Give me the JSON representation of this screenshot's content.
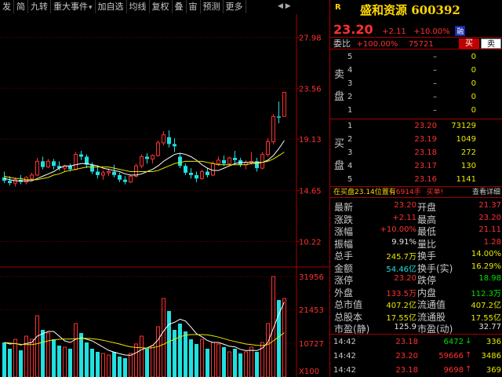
{
  "toolbar": {
    "items": [
      {
        "label": "发",
        "dropdown": false
      },
      {
        "label": "简",
        "dropdown": false
      },
      {
        "label": "九转",
        "dropdown": false
      },
      {
        "label": "重大事件",
        "dropdown": true
      },
      {
        "label": "加自选",
        "dropdown": false
      },
      {
        "label": "均线",
        "dropdown": false
      },
      {
        "label": "复权",
        "dropdown": false
      },
      {
        "label": "叠",
        "dropdown": false
      },
      {
        "label": "宙",
        "dropdown": false
      },
      {
        "label": "预测",
        "dropdown": false
      },
      {
        "label": "更多",
        "dropdown": false
      }
    ],
    "scroll_arrows": "◀ ▶"
  },
  "chart_data": {
    "type": "candlestick",
    "price_axis": {
      "ticks": [
        "27.98",
        "23.56",
        "19.13",
        "14.65",
        "10.22"
      ],
      "ylim": [
        8.0,
        30.0
      ]
    },
    "volume_axis": {
      "ticks": [
        "31956",
        "21453",
        "10727"
      ],
      "unit_label": "X100",
      "ylim": [
        0,
        35000
      ]
    },
    "colors": {
      "up": "#ff3030",
      "down": "#20e0e0",
      "ma1": "#ffffff",
      "ma2": "#e8e800",
      "grid": "#6a0000"
    },
    "candles": [
      {
        "o": 15.8,
        "h": 16.3,
        "l": 15.3,
        "c": 15.5
      },
      {
        "o": 15.5,
        "h": 15.9,
        "l": 15.1,
        "c": 15.3
      },
      {
        "o": 15.3,
        "h": 15.8,
        "l": 15.0,
        "c": 15.6
      },
      {
        "o": 15.6,
        "h": 16.0,
        "l": 15.2,
        "c": 15.4
      },
      {
        "o": 15.4,
        "h": 15.9,
        "l": 15.2,
        "c": 15.8
      },
      {
        "o": 15.7,
        "h": 16.2,
        "l": 15.5,
        "c": 16.0
      },
      {
        "o": 16.0,
        "h": 17.5,
        "l": 15.9,
        "c": 17.2
      },
      {
        "o": 17.2,
        "h": 17.6,
        "l": 16.5,
        "c": 16.7
      },
      {
        "o": 16.7,
        "h": 17.4,
        "l": 16.6,
        "c": 17.2
      },
      {
        "o": 17.2,
        "h": 17.4,
        "l": 16.5,
        "c": 16.8
      },
      {
        "o": 16.8,
        "h": 17.2,
        "l": 16.4,
        "c": 16.6
      },
      {
        "o": 16.6,
        "h": 16.9,
        "l": 16.3,
        "c": 16.8
      },
      {
        "o": 16.8,
        "h": 17.0,
        "l": 16.3,
        "c": 16.5
      },
      {
        "o": 16.5,
        "h": 18.0,
        "l": 16.4,
        "c": 17.8
      },
      {
        "o": 17.8,
        "h": 18.1,
        "l": 17.3,
        "c": 17.6
      },
      {
        "o": 17.6,
        "h": 17.8,
        "l": 16.6,
        "c": 16.9
      },
      {
        "o": 16.9,
        "h": 17.1,
        "l": 16.1,
        "c": 16.3
      },
      {
        "o": 16.3,
        "h": 16.8,
        "l": 15.7,
        "c": 16.0
      },
      {
        "o": 16.0,
        "h": 16.4,
        "l": 15.6,
        "c": 16.2
      },
      {
        "o": 16.2,
        "h": 16.6,
        "l": 15.9,
        "c": 16.3
      },
      {
        "o": 16.3,
        "h": 16.9,
        "l": 15.8,
        "c": 16.0
      },
      {
        "o": 16.0,
        "h": 16.2,
        "l": 15.4,
        "c": 15.6
      },
      {
        "o": 15.6,
        "h": 15.9,
        "l": 15.2,
        "c": 15.4
      },
      {
        "o": 15.4,
        "h": 16.0,
        "l": 15.3,
        "c": 15.9
      },
      {
        "o": 15.9,
        "h": 17.0,
        "l": 15.8,
        "c": 16.8
      },
      {
        "o": 16.8,
        "h": 17.8,
        "l": 16.6,
        "c": 17.6
      },
      {
        "o": 17.6,
        "h": 17.9,
        "l": 17.0,
        "c": 17.4
      },
      {
        "o": 17.4,
        "h": 17.8,
        "l": 17.0,
        "c": 17.7
      },
      {
        "o": 17.7,
        "h": 19.0,
        "l": 17.6,
        "c": 18.8
      },
      {
        "o": 18.8,
        "h": 19.8,
        "l": 18.6,
        "c": 19.5
      },
      {
        "o": 19.3,
        "h": 19.9,
        "l": 18.4,
        "c": 18.7
      },
      {
        "o": 18.7,
        "h": 19.2,
        "l": 18.0,
        "c": 18.5
      },
      {
        "o": 17.6,
        "h": 17.9,
        "l": 16.6,
        "c": 16.8
      },
      {
        "o": 16.8,
        "h": 17.0,
        "l": 16.0,
        "c": 16.2
      },
      {
        "o": 16.2,
        "h": 16.6,
        "l": 15.7,
        "c": 16.0
      },
      {
        "o": 16.0,
        "h": 16.3,
        "l": 15.4,
        "c": 15.7
      },
      {
        "o": 15.7,
        "h": 16.5,
        "l": 15.6,
        "c": 16.3
      },
      {
        "o": 16.3,
        "h": 16.6,
        "l": 15.8,
        "c": 16.0
      },
      {
        "o": 16.0,
        "h": 17.2,
        "l": 15.9,
        "c": 17.0
      },
      {
        "o": 17.0,
        "h": 17.6,
        "l": 16.8,
        "c": 17.3
      },
      {
        "o": 17.3,
        "h": 17.7,
        "l": 16.8,
        "c": 17.0
      },
      {
        "o": 17.0,
        "h": 17.6,
        "l": 16.9,
        "c": 17.5
      },
      {
        "o": 17.5,
        "h": 18.1,
        "l": 17.0,
        "c": 17.3
      },
      {
        "o": 17.3,
        "h": 17.5,
        "l": 16.7,
        "c": 16.9
      },
      {
        "o": 16.9,
        "h": 17.3,
        "l": 16.5,
        "c": 17.1
      },
      {
        "o": 17.1,
        "h": 18.0,
        "l": 16.9,
        "c": 17.2
      },
      {
        "o": 17.2,
        "h": 17.5,
        "l": 16.3,
        "c": 16.6
      },
      {
        "o": 16.6,
        "h": 18.0,
        "l": 16.5,
        "c": 17.8
      },
      {
        "o": 17.8,
        "h": 19.2,
        "l": 17.6,
        "c": 18.9
      },
      {
        "o": 18.9,
        "h": 21.3,
        "l": 18.7,
        "c": 21.1
      },
      {
        "o": 21.1,
        "h": 22.4,
        "l": 20.5,
        "c": 21.0
      },
      {
        "o": 21.1,
        "h": 23.2,
        "l": 21.1,
        "c": 23.2
      }
    ],
    "volumes": [
      {
        "v": 11000,
        "up": false
      },
      {
        "v": 9000,
        "up": false
      },
      {
        "v": 12000,
        "up": true
      },
      {
        "v": 8500,
        "up": false
      },
      {
        "v": 13000,
        "up": true
      },
      {
        "v": 12000,
        "up": true
      },
      {
        "v": 19500,
        "up": true
      },
      {
        "v": 15000,
        "up": false
      },
      {
        "v": 14000,
        "up": true
      },
      {
        "v": 12000,
        "up": false
      },
      {
        "v": 10000,
        "up": false
      },
      {
        "v": 9500,
        "up": true
      },
      {
        "v": 9000,
        "up": false
      },
      {
        "v": 17000,
        "up": true
      },
      {
        "v": 14000,
        "up": false
      },
      {
        "v": 11000,
        "up": false
      },
      {
        "v": 9000,
        "up": false
      },
      {
        "v": 8000,
        "up": false
      },
      {
        "v": 7500,
        "up": true
      },
      {
        "v": 7000,
        "up": true
      },
      {
        "v": 8000,
        "up": false
      },
      {
        "v": 6500,
        "up": false
      },
      {
        "v": 6000,
        "up": false
      },
      {
        "v": 7500,
        "up": true
      },
      {
        "v": 10500,
        "up": true
      },
      {
        "v": 13000,
        "up": true
      },
      {
        "v": 9000,
        "up": false
      },
      {
        "v": 10000,
        "up": true
      },
      {
        "v": 16000,
        "up": true
      },
      {
        "v": 25000,
        "up": true
      },
      {
        "v": 21000,
        "up": false
      },
      {
        "v": 15000,
        "up": false
      },
      {
        "v": 17000,
        "up": false
      },
      {
        "v": 14500,
        "up": false
      },
      {
        "v": 12000,
        "up": false
      },
      {
        "v": 10500,
        "up": false
      },
      {
        "v": 12000,
        "up": true
      },
      {
        "v": 9000,
        "up": false
      },
      {
        "v": 11000,
        "up": true
      },
      {
        "v": 10500,
        "up": true
      },
      {
        "v": 9500,
        "up": false
      },
      {
        "v": 8000,
        "up": true
      },
      {
        "v": 9000,
        "up": false
      },
      {
        "v": 7500,
        "up": false
      },
      {
        "v": 8000,
        "up": true
      },
      {
        "v": 9500,
        "up": true
      },
      {
        "v": 8000,
        "up": false
      },
      {
        "v": 11000,
        "up": true
      },
      {
        "v": 17000,
        "up": true
      },
      {
        "v": 31956,
        "up": true
      },
      {
        "v": 24500,
        "up": false
      },
      {
        "v": 25000,
        "up": true
      }
    ],
    "ma_price": [
      [
        15.7,
        15.6,
        15.5,
        15.5,
        15.5,
        15.5,
        15.7,
        15.9,
        16.1,
        16.3,
        16.6,
        16.8,
        16.8,
        16.9,
        17.0,
        17.0,
        16.9,
        16.8,
        16.6,
        16.5,
        16.4,
        16.3,
        16.1,
        16.0,
        16.0,
        16.1,
        16.3,
        16.5,
        16.8,
        17.2,
        17.5,
        17.8,
        17.9,
        17.8,
        17.6,
        17.3,
        16.9,
        16.6,
        16.4,
        16.4,
        16.6,
        16.8,
        17.0,
        17.1,
        17.1,
        17.1,
        17.1,
        17.1,
        17.3,
        17.7,
        18.3,
        19.0
      ],
      [
        15.9,
        15.8,
        15.7,
        15.7,
        15.6,
        15.6,
        15.6,
        15.7,
        15.8,
        16.0,
        16.1,
        16.3,
        16.4,
        16.5,
        16.6,
        16.7,
        16.7,
        16.7,
        16.7,
        16.7,
        16.6,
        16.5,
        16.4,
        16.3,
        16.3,
        16.3,
        16.3,
        16.3,
        16.4,
        16.6,
        16.8,
        17.0,
        17.1,
        17.2,
        17.2,
        17.2,
        17.2,
        17.1,
        17.0,
        16.9,
        16.9,
        16.9,
        16.9,
        16.9,
        16.9,
        17.0,
        17.0,
        17.1,
        17.2,
        17.4,
        17.7,
        18.0
      ]
    ],
    "ma_volume": [
      [
        11000,
        10500,
        10700,
        10200,
        10700,
        11000,
        13000,
        13800,
        14500,
        14500,
        13000,
        11500,
        11000,
        12000,
        12500,
        12000,
        11500,
        10500,
        9500,
        8500,
        7900,
        7400,
        7000,
        6900,
        7700,
        8700,
        9300,
        10000,
        11800,
        14600,
        16800,
        17400,
        18400,
        17800,
        15900,
        13800,
        12800,
        11600,
        11000,
        11000,
        10400,
        9800,
        9600,
        8800,
        8400,
        8500,
        8400,
        9200,
        11000,
        15500,
        20000,
        23900
      ],
      [
        11000,
        10800,
        10600,
        10400,
        10300,
        10300,
        10600,
        11100,
        11500,
        11800,
        12000,
        12100,
        12100,
        12200,
        12300,
        12300,
        12200,
        12000,
        11700,
        11300,
        10900,
        10500,
        10000,
        9600,
        9400,
        9300,
        9200,
        9300,
        9700,
        10400,
        11300,
        12000,
        12800,
        13300,
        13500,
        13500,
        13500,
        13400,
        13100,
        12700,
        12200,
        11700,
        11300,
        10900,
        10500,
        10300,
        10100,
        10000,
        10300,
        11500,
        12800,
        14100
      ]
    ]
  },
  "panel": {
    "badge": "R",
    "stock_name": "盛和资源",
    "stock_code": "600392",
    "price": "23.20",
    "change": "+2.11",
    "change_pct": "+10.00%",
    "market_tag": "融",
    "weibi_label": "委比",
    "weibi_pct": "+100.00%",
    "weibi_diff": "75721",
    "buy_label": "买",
    "sell_label": "卖",
    "sell_side_label": [
      "卖",
      "盘"
    ],
    "buy_side_label": [
      "买",
      "盘"
    ],
    "asks": [
      {
        "level": "5",
        "price": "–",
        "vol": "0"
      },
      {
        "level": "4",
        "price": "–",
        "vol": "0"
      },
      {
        "level": "3",
        "price": "–",
        "vol": "0"
      },
      {
        "level": "2",
        "price": "–",
        "vol": "0"
      },
      {
        "level": "1",
        "price": "–",
        "vol": "0"
      }
    ],
    "bids": [
      {
        "level": "1",
        "price": "23.20",
        "vol": "73129"
      },
      {
        "level": "2",
        "price": "23.19",
        "vol": "1049"
      },
      {
        "level": "3",
        "price": "23.18",
        "vol": "272"
      },
      {
        "level": "4",
        "price": "23.17",
        "vol": "130"
      },
      {
        "level": "5",
        "price": "23.16",
        "vol": "1141"
      }
    ],
    "notice_prefix": "在买盘23.14位置有",
    "notice_qty": "6914手",
    "notice_action": "买单!",
    "notice_link": "查看详细",
    "stats": [
      {
        "k": "最新",
        "v": "23.20",
        "vc": "red",
        "k2": "开盘",
        "v2": "21.37",
        "v2c": "red"
      },
      {
        "k": "涨跌",
        "v": "+2.11",
        "vc": "red",
        "k2": "最高",
        "v2": "23.20",
        "v2c": "red"
      },
      {
        "k": "涨幅",
        "v": "+10.00%",
        "vc": "red",
        "k2": "最低",
        "v2": "21.11",
        "v2c": "red"
      },
      {
        "k": "振幅",
        "v": "9.91%",
        "vc": "white",
        "k2": "量比",
        "v2": "1.28",
        "v2c": "red"
      },
      {
        "k": "总手",
        "v": "245.7万",
        "vc": "yellow",
        "k2": "换手",
        "v2": "14.00%",
        "v2c": "yellow"
      },
      {
        "k": "金额",
        "v": "54.46亿",
        "vc": "cyan",
        "k2": "换手(实)",
        "v2": "16.29%",
        "v2c": "yellow"
      },
      {
        "k": "涨停",
        "v": "23.20",
        "vc": "red",
        "k2": "跌停",
        "v2": "18.98",
        "v2c": "green"
      },
      {
        "k": "外盘",
        "v": "133.5万",
        "vc": "red",
        "k2": "内盘",
        "v2": "112.3万",
        "v2c": "green"
      },
      {
        "k": "总市值",
        "v": "407.2亿",
        "vc": "yellow",
        "k2": "流通值",
        "v2": "407.2亿",
        "v2c": "yellow"
      },
      {
        "k": "总股本",
        "v": "17.55亿",
        "vc": "yellow",
        "k2": "流通股",
        "v2": "17.55亿",
        "v2c": "yellow"
      },
      {
        "k": "市盈(静)",
        "v": "125.9",
        "vc": "white",
        "k2": "市盈(动)",
        "v2": "32.77",
        "v2c": "white"
      }
    ],
    "ticks": [
      {
        "t": "14:42",
        "p": "23.18",
        "v": "6472",
        "vc": "green",
        "arrow": "↓",
        "ac": "green",
        "n": "336"
      },
      {
        "t": "14:42",
        "p": "23.20",
        "v": "59666",
        "vc": "red",
        "arrow": "↑",
        "ac": "red",
        "n": "3486"
      },
      {
        "t": "14:42",
        "p": "23.18",
        "v": "9698",
        "vc": "red",
        "arrow": "↑",
        "ac": "red",
        "n": "369"
      }
    ]
  }
}
